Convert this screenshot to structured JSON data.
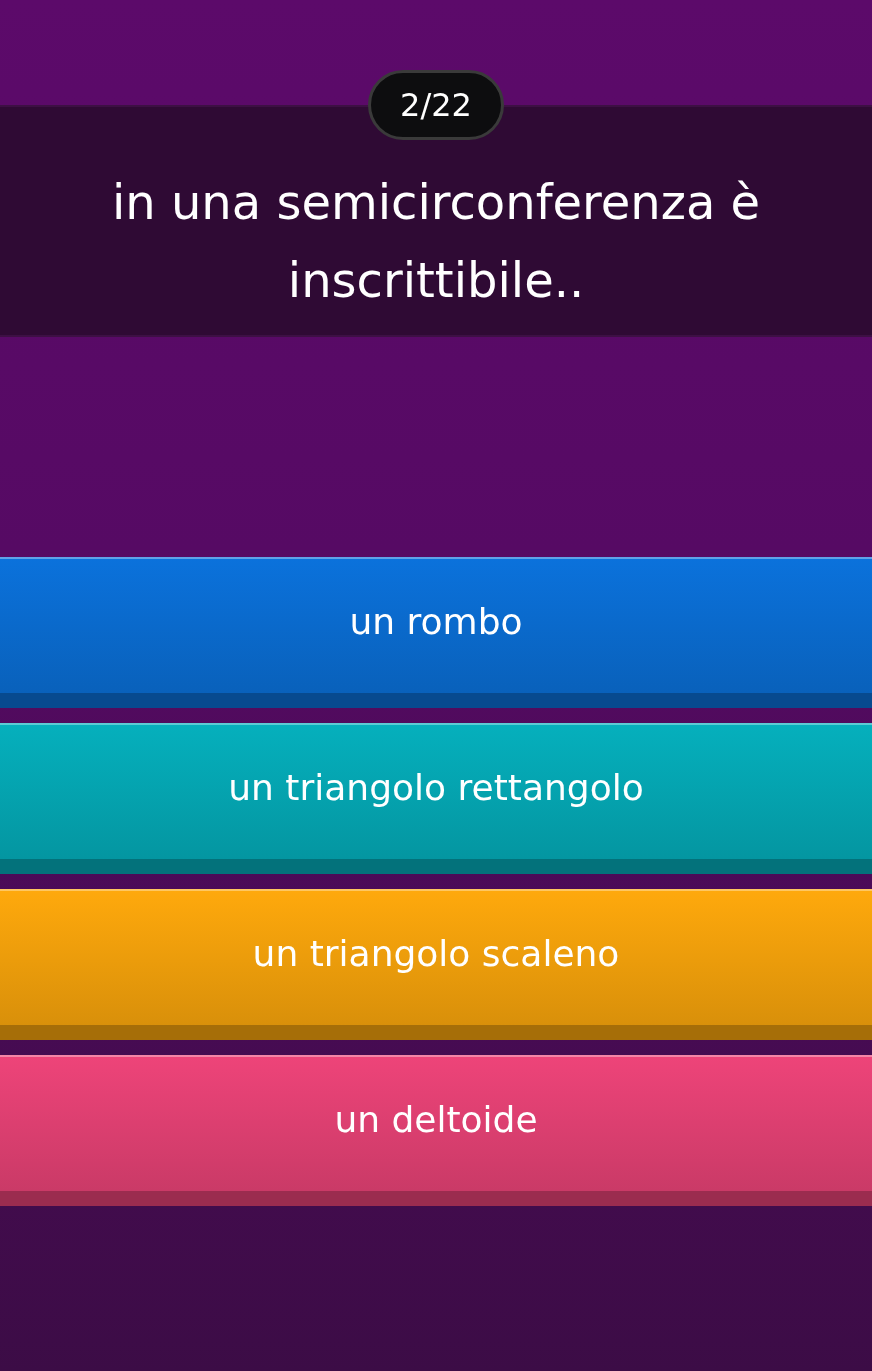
{
  "counter": "2/22",
  "question": "in una semicirconferenza è inscrittibile..",
  "answers": [
    {
      "label": "un rombo",
      "color": "#0b72dc"
    },
    {
      "label": "un triangolo rettangolo",
      "color": "#05b0bd"
    },
    {
      "label": "un triangolo scaleno",
      "color": "#ffa90c"
    },
    {
      "label": "un deltoide",
      "color": "#ee4479"
    }
  ]
}
